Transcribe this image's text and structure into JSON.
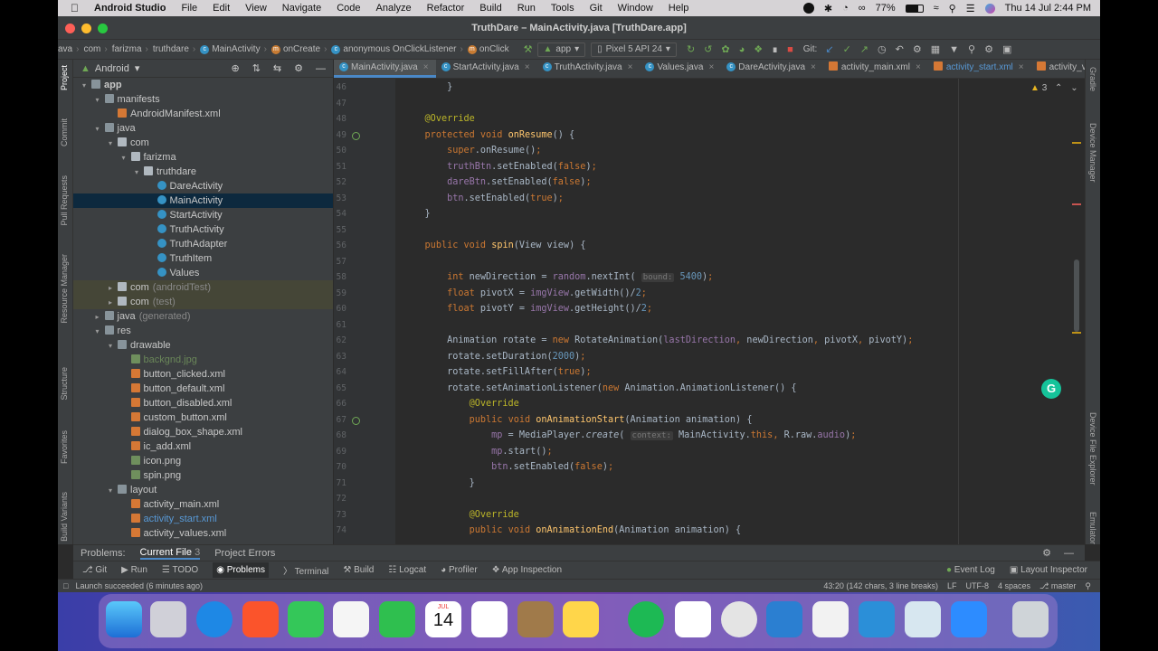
{
  "menubar": {
    "app_name": "Android Studio",
    "items": [
      "File",
      "Edit",
      "View",
      "Navigate",
      "Code",
      "Analyze",
      "Refactor",
      "Build",
      "Run",
      "Tools",
      "Git",
      "Window",
      "Help"
    ],
    "battery": "77%",
    "datetime": "Thu 14 Jul  2:44 PM"
  },
  "window": {
    "title": "TruthDare – MainActivity.java [TruthDare.app]"
  },
  "navbar": {
    "crumbs": [
      "ava",
      "com",
      "farizma",
      "truthdare",
      "MainActivity",
      "onCreate",
      "anonymous OnClickListener",
      "onClick"
    ],
    "run_config": "app",
    "device": "Pixel 5 API 24",
    "git_label": "Git:"
  },
  "project": {
    "view_label": "Android",
    "tree": [
      {
        "label": "app",
        "depth": 0,
        "arrow": "▾",
        "icon": "folder",
        "style": "bold"
      },
      {
        "label": "manifests",
        "depth": 1,
        "arrow": "▾",
        "icon": "folder"
      },
      {
        "label": "AndroidManifest.xml",
        "depth": 2,
        "arrow": "",
        "icon": "xml"
      },
      {
        "label": "java",
        "depth": 1,
        "arrow": "▾",
        "icon": "folder"
      },
      {
        "label": "com",
        "depth": 2,
        "arrow": "▾",
        "icon": "pkg"
      },
      {
        "label": "farizma",
        "depth": 3,
        "arrow": "▾",
        "icon": "pkg"
      },
      {
        "label": "truthdare",
        "depth": 4,
        "arrow": "▾",
        "icon": "pkg"
      },
      {
        "label": "DareActivity",
        "depth": 5,
        "arrow": "",
        "icon": "cls"
      },
      {
        "label": "MainActivity",
        "depth": 5,
        "arrow": "",
        "icon": "cls",
        "state": "sel"
      },
      {
        "label": "StartActivity",
        "depth": 5,
        "arrow": "",
        "icon": "cls"
      },
      {
        "label": "TruthActivity",
        "depth": 5,
        "arrow": "",
        "icon": "cls"
      },
      {
        "label": "TruthAdapter",
        "depth": 5,
        "arrow": "",
        "icon": "cls"
      },
      {
        "label": "TruthItem",
        "depth": 5,
        "arrow": "",
        "icon": "cls"
      },
      {
        "label": "Values",
        "depth": 5,
        "arrow": "",
        "icon": "cls"
      },
      {
        "label": "com",
        "suffix": "(androidTest)",
        "depth": 2,
        "arrow": "▸",
        "icon": "pkg",
        "state": "hl"
      },
      {
        "label": "com",
        "suffix": "(test)",
        "depth": 2,
        "arrow": "▸",
        "icon": "pkg",
        "state": "hl"
      },
      {
        "label": "java",
        "suffix": "(generated)",
        "depth": 1,
        "arrow": "▸",
        "icon": "folder"
      },
      {
        "label": "res",
        "depth": 1,
        "arrow": "▾",
        "icon": "folder"
      },
      {
        "label": "drawable",
        "depth": 2,
        "arrow": "▾",
        "icon": "folder"
      },
      {
        "label": "backgnd.jpg",
        "depth": 3,
        "arrow": "",
        "icon": "img",
        "color": "green"
      },
      {
        "label": "button_clicked.xml",
        "depth": 3,
        "arrow": "",
        "icon": "xml"
      },
      {
        "label": "button_default.xml",
        "depth": 3,
        "arrow": "",
        "icon": "xml"
      },
      {
        "label": "button_disabled.xml",
        "depth": 3,
        "arrow": "",
        "icon": "xml"
      },
      {
        "label": "custom_button.xml",
        "depth": 3,
        "arrow": "",
        "icon": "xml"
      },
      {
        "label": "dialog_box_shape.xml",
        "depth": 3,
        "arrow": "",
        "icon": "xml"
      },
      {
        "label": "ic_add.xml",
        "depth": 3,
        "arrow": "",
        "icon": "xml"
      },
      {
        "label": "icon.png",
        "depth": 3,
        "arrow": "",
        "icon": "img"
      },
      {
        "label": "spin.png",
        "depth": 3,
        "arrow": "",
        "icon": "img"
      },
      {
        "label": "layout",
        "depth": 2,
        "arrow": "▾",
        "icon": "folder"
      },
      {
        "label": "activity_main.xml",
        "depth": 3,
        "arrow": "",
        "icon": "xml"
      },
      {
        "label": "activity_start.xml",
        "depth": 3,
        "arrow": "",
        "icon": "xml",
        "color": "blue"
      },
      {
        "label": "activity_values.xml",
        "depth": 3,
        "arrow": "",
        "icon": "xml"
      }
    ]
  },
  "editor_tabs": [
    {
      "label": "MainActivity.java",
      "active": true
    },
    {
      "label": "StartActivity.java"
    },
    {
      "label": "TruthActivity.java"
    },
    {
      "label": "Values.java"
    },
    {
      "label": "DareActivity.java"
    },
    {
      "label": "activity_main.xml"
    },
    {
      "label": "activity_start.xml",
      "color": "blue"
    },
    {
      "label": "activity_va"
    }
  ],
  "inspection": {
    "warnings": "3"
  },
  "code_lines": [
    {
      "n": "46",
      "t": "        }"
    },
    {
      "n": "47",
      "t": ""
    },
    {
      "n": "48",
      "t": "    @Override"
    },
    {
      "n": "49",
      "t": "    protected void onResume() {"
    },
    {
      "n": "50",
      "t": "        super.onResume();"
    },
    {
      "n": "51",
      "t": "        truthBtn.setEnabled(false);"
    },
    {
      "n": "52",
      "t": "        dareBtn.setEnabled(false);"
    },
    {
      "n": "53",
      "t": "        btn.setEnabled(true);"
    },
    {
      "n": "54",
      "t": "    }"
    },
    {
      "n": "55",
      "t": ""
    },
    {
      "n": "56",
      "t": "    public void spin(View view) {"
    },
    {
      "n": "57",
      "t": ""
    },
    {
      "n": "58",
      "t": "        int newDirection = random.nextInt( bound: 5400);"
    },
    {
      "n": "59",
      "t": "        float pivotX = imgView.getWidth()/2;"
    },
    {
      "n": "60",
      "t": "        float pivotY = imgView.getHeight()/2;"
    },
    {
      "n": "61",
      "t": ""
    },
    {
      "n": "62",
      "t": "        Animation rotate = new RotateAnimation(lastDirection, newDirection, pivotX, pivotY);"
    },
    {
      "n": "63",
      "t": "        rotate.setDuration(2000);"
    },
    {
      "n": "64",
      "t": "        rotate.setFillAfter(true);"
    },
    {
      "n": "65",
      "t": "        rotate.setAnimationListener(new Animation.AnimationListener() {"
    },
    {
      "n": "66",
      "t": "            @Override"
    },
    {
      "n": "67",
      "t": "            public void onAnimationStart(Animation animation) {"
    },
    {
      "n": "68",
      "t": "                mp = MediaPlayer.create( context: MainActivity.this, R.raw.audio);"
    },
    {
      "n": "69",
      "t": "                mp.start();"
    },
    {
      "n": "70",
      "t": "                btn.setEnabled(false);"
    },
    {
      "n": "71",
      "t": "            }"
    },
    {
      "n": "72",
      "t": ""
    },
    {
      "n": "73",
      "t": "            @Override"
    },
    {
      "n": "74",
      "t": "            public void onAnimationEnd(Animation animation) {"
    }
  ],
  "problems_bar": {
    "tabs": [
      "Problems:",
      "Current File",
      "Project Errors"
    ],
    "current_file_count": "3"
  },
  "tool_windows": [
    "Git",
    "Run",
    "TODO",
    "Problems",
    "Terminal",
    "Build",
    "Logcat",
    "Profiler",
    "App Inspection"
  ],
  "tool_windows_right": [
    "Event Log",
    "Layout Inspector"
  ],
  "statusbar": {
    "message": "Launch succeeded (6 minutes ago)",
    "position": "43:20 (142 chars, 3 line breaks)",
    "line_sep": "LF",
    "encoding": "UTF-8",
    "indent": "4 spaces",
    "branch": "master"
  },
  "left_stripe": [
    "Project",
    "Commit",
    "Pull Requests",
    "Resource Manager",
    "Structure",
    "Favorites",
    "Build Variants"
  ],
  "right_stripe": [
    "Gradle",
    "Device Manager",
    "Device File Explorer",
    "Emulator"
  ],
  "dock": {
    "calendar_month": "JUL",
    "calendar_day": "14"
  }
}
